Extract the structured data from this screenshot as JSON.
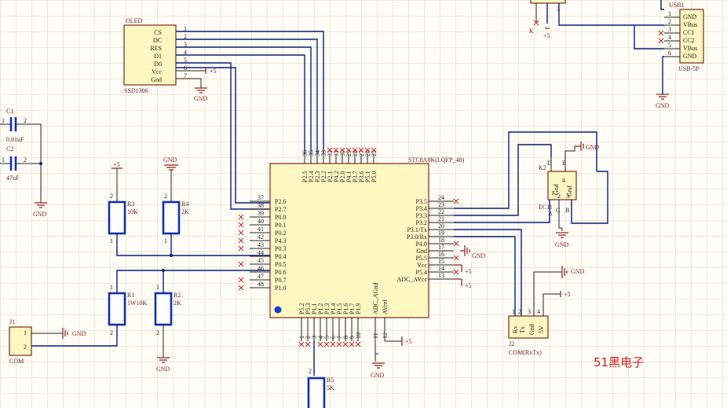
{
  "oled": {
    "ref": "OLED",
    "part": "SSD1306",
    "pins": [
      "CS",
      "DC",
      "RES",
      "D1",
      "D0",
      "Vcc",
      "Gnd"
    ],
    "pin_numbers": [
      "1",
      "2",
      "3",
      "4",
      "5",
      "6",
      "7"
    ],
    "vcc_label": "+5",
    "gnd_label": "GND"
  },
  "usb": {
    "ref": "USB1",
    "part": "USB-5P",
    "pins": [
      "GND",
      "VBus",
      "CC1",
      "CC2",
      "VBus",
      "GND"
    ],
    "pin_numbers": [
      "1",
      "2",
      "3",
      "4",
      "5",
      "6"
    ],
    "gnd_label": "GND",
    "k_label": "K",
    "plus_label": "+5",
    "top_pin": "3"
  },
  "caps": [
    {
      "ref": "C1",
      "value": "0.01uF",
      "pin1": "1",
      "pin2": "2"
    },
    {
      "ref": "C2",
      "value": "47uF",
      "pin1": "1",
      "pin2": "2"
    }
  ],
  "cap_gnd": "GND",
  "resistors": [
    {
      "ref": "R3",
      "value": "10K",
      "pin1": "1",
      "pin2": "2",
      "supply": "+5"
    },
    {
      "ref": "R4",
      "value": "2K",
      "pin1": "1",
      "pin2": "2",
      "supply": "GND"
    },
    {
      "ref": "R1",
      "value": "1W10K",
      "pin1": "1",
      "pin2": "2"
    },
    {
      "ref": "R2",
      "value": "2K",
      "pin1": "1",
      "pin2": "2",
      "gnd": "GND"
    },
    {
      "ref": "R5",
      "value": "5K",
      "pin2": "2"
    }
  ],
  "mcu": {
    "part": "STC8A8K(LQFP_48)",
    "top_pins": [
      "P2.5",
      "P2.4",
      "P2.3",
      "P2.2",
      "P2.1",
      "P4.2",
      "P2.0",
      "P4.1",
      "P3.7",
      "P3.6",
      "P5.1",
      "P5.0"
    ],
    "top_numbers": [
      "36",
      "35",
      "34",
      "33",
      "32",
      "31",
      "30",
      "29",
      "28",
      "27",
      "26",
      "25"
    ],
    "left_pins": [
      "P2.6",
      "P2.7",
      "P0.0",
      "P0.1",
      "P0.2",
      "P4.3",
      "P0.3",
      "P0.4",
      "P0.5",
      "P0.6",
      "P0.7",
      "P1.0"
    ],
    "left_numbers": [
      "37",
      "38",
      "39",
      "40",
      "41",
      "42",
      "43",
      "44",
      "45",
      "46",
      "47",
      "48"
    ],
    "right_pins": [
      "P3.5",
      "P3.4",
      "P3.3",
      "P3.2",
      "P3.1/Tx",
      "P3.0/Rx",
      "P4.0",
      "Gnd",
      "P5.5",
      "Vcc",
      "P5.4",
      "ADC_AVcc"
    ],
    "right_numbers": [
      "24",
      "23",
      "22",
      "21",
      "20",
      "19",
      "18",
      "17",
      "16",
      "15",
      "14",
      "13"
    ],
    "bottom_pins": [
      "P5.2",
      "P5.3",
      "P1.1",
      "P1.2",
      "P1.3",
      "P1.4",
      "P1.5",
      "P1.6",
      "P1.7",
      "P1.9",
      "ADC_AGnd",
      "AVref"
    ],
    "bottom_numbers": [
      "1",
      "2",
      "3",
      "4",
      "5",
      "6",
      "7",
      "8",
      "9",
      "10",
      "11",
      "12"
    ],
    "gnd_label": "GND",
    "vcc_label": "+5",
    "bottom_plus": "+5",
    "bottom_gnd": "GND"
  },
  "ec11": {
    "ref": "K2",
    "part": "EC11",
    "pin_labels": [
      "D",
      "E",
      "1",
      "2",
      "3"
    ],
    "pin_names": [
      "Gnd",
      "Gnd"
    ],
    "side_labels": [
      "A",
      "C",
      "B"
    ],
    "pin4": "4",
    "gnd_label": "GND",
    "gnd2_label": "GND"
  },
  "j1": {
    "ref": "J1",
    "part": "COM",
    "pins": [
      "1",
      "2"
    ],
    "gnd_label": "GND"
  },
  "j2": {
    "ref": "J2",
    "part": "COM(RxTx)",
    "pins": [
      "Rx",
      "Tx",
      "Gnd",
      "5V"
    ],
    "pin_numbers": [
      "1",
      "2",
      "3",
      "4"
    ],
    "gnd_label": "GND",
    "plus_label": "+5"
  },
  "brand": "51黑电子"
}
